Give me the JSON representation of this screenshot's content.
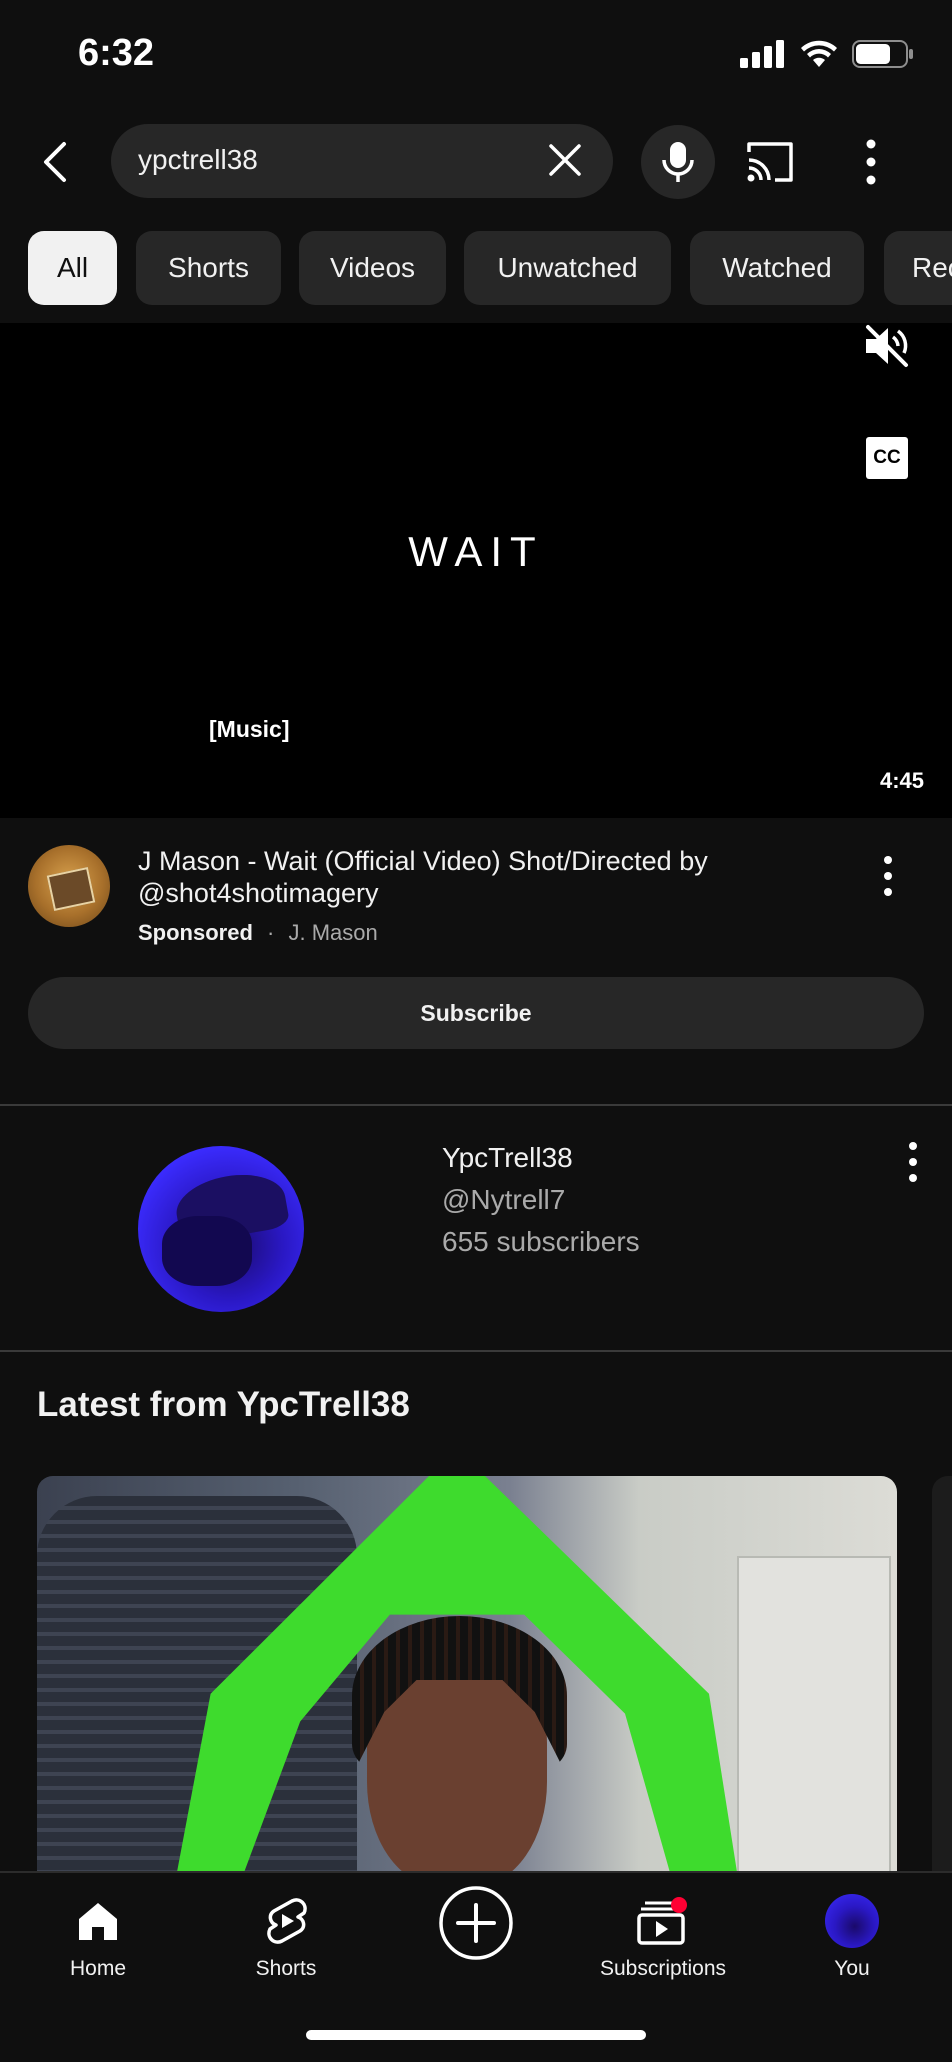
{
  "status_bar": {
    "time": "6:32",
    "icons": [
      "signal-icon",
      "wifi-icon",
      "battery-icon"
    ]
  },
  "search": {
    "query": "ypctrell38",
    "icons": [
      "back-icon",
      "clear-icon",
      "mic-icon",
      "cast-icon",
      "more-vert-icon"
    ]
  },
  "chips": [
    {
      "label": "All",
      "active": true
    },
    {
      "label": "Shorts",
      "active": false
    },
    {
      "label": "Videos",
      "active": false
    },
    {
      "label": "Unwatched",
      "active": false
    },
    {
      "label": "Watched",
      "active": false
    },
    {
      "label": "Rec",
      "active": false
    }
  ],
  "video": {
    "overlay_title": "WAIT",
    "caption": "[Music]",
    "duration": "4:45",
    "cc_label": "CC"
  },
  "ad": {
    "title": "J Mason - Wait (Official Video) Shot/Directed by @shot4shotimagery",
    "sponsored_label": "Sponsored",
    "separator": "·",
    "advertiser": "J. Mason",
    "subscribe_label": "Subscribe"
  },
  "channel": {
    "name": "YpcTrell38",
    "handle": "@Nytrell7",
    "subscribers": "655 subscribers"
  },
  "latest": {
    "title": "Latest from YpcTrell38"
  },
  "bottom_nav": [
    {
      "label": "Home",
      "icon": "home-icon"
    },
    {
      "label": "Shorts",
      "icon": "shorts-icon"
    },
    {
      "label": "",
      "icon": "create-icon"
    },
    {
      "label": "Subscriptions",
      "icon": "subscriptions-icon"
    },
    {
      "label": "You",
      "icon": "avatar"
    }
  ],
  "colors": {
    "background": "#0f0f0f",
    "chip_bg": "#272727",
    "chip_active_bg": "#f1f1f1",
    "notification_dot": "#ff0033"
  }
}
